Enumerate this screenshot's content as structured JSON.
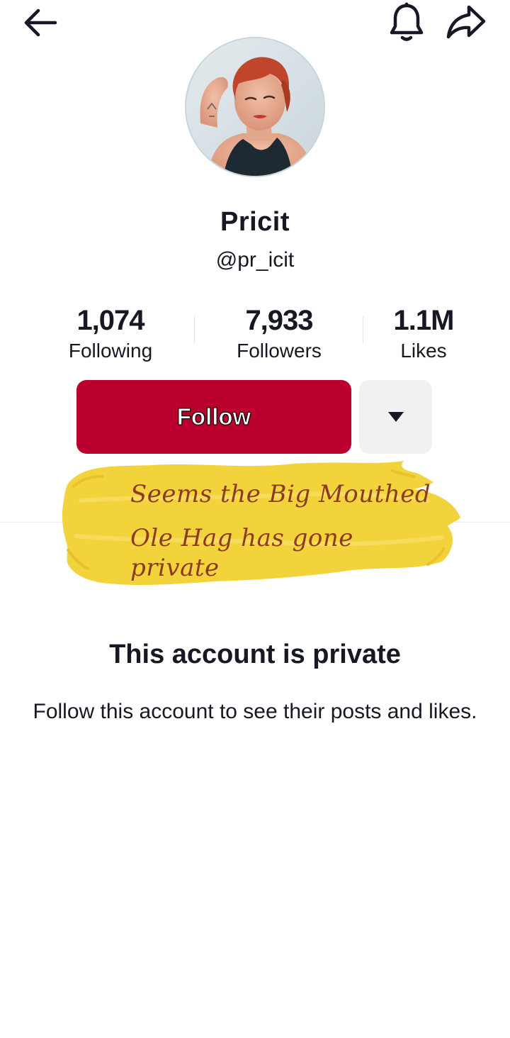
{
  "header": {
    "back_icon": "arrow-left-icon",
    "notification_icon": "bell-icon",
    "share_icon": "share-arrow-icon"
  },
  "profile": {
    "display_name": "Pricit",
    "username": "@pr_icit"
  },
  "stats": {
    "following": {
      "value": "1,074",
      "label": "Following"
    },
    "followers": {
      "value": "7,933",
      "label": "Followers"
    },
    "likes": {
      "value": "1.1M",
      "label": "Likes"
    }
  },
  "actions": {
    "follow_label": "Follow",
    "more_icon": "caret-down-icon"
  },
  "overlay_sticker": {
    "line1": "Seems the Big Mouthed",
    "line2": "Ole Hag has gone private"
  },
  "private_notice": {
    "title": "This account is private",
    "description": "Follow this account to see their posts and likes."
  },
  "colors": {
    "follow_button": "#bb002f",
    "secondary_button": "#f1f1f2",
    "sticker_yellow": "#f3d33c",
    "sticker_text": "#8a3b22",
    "text_primary": "#161823"
  }
}
